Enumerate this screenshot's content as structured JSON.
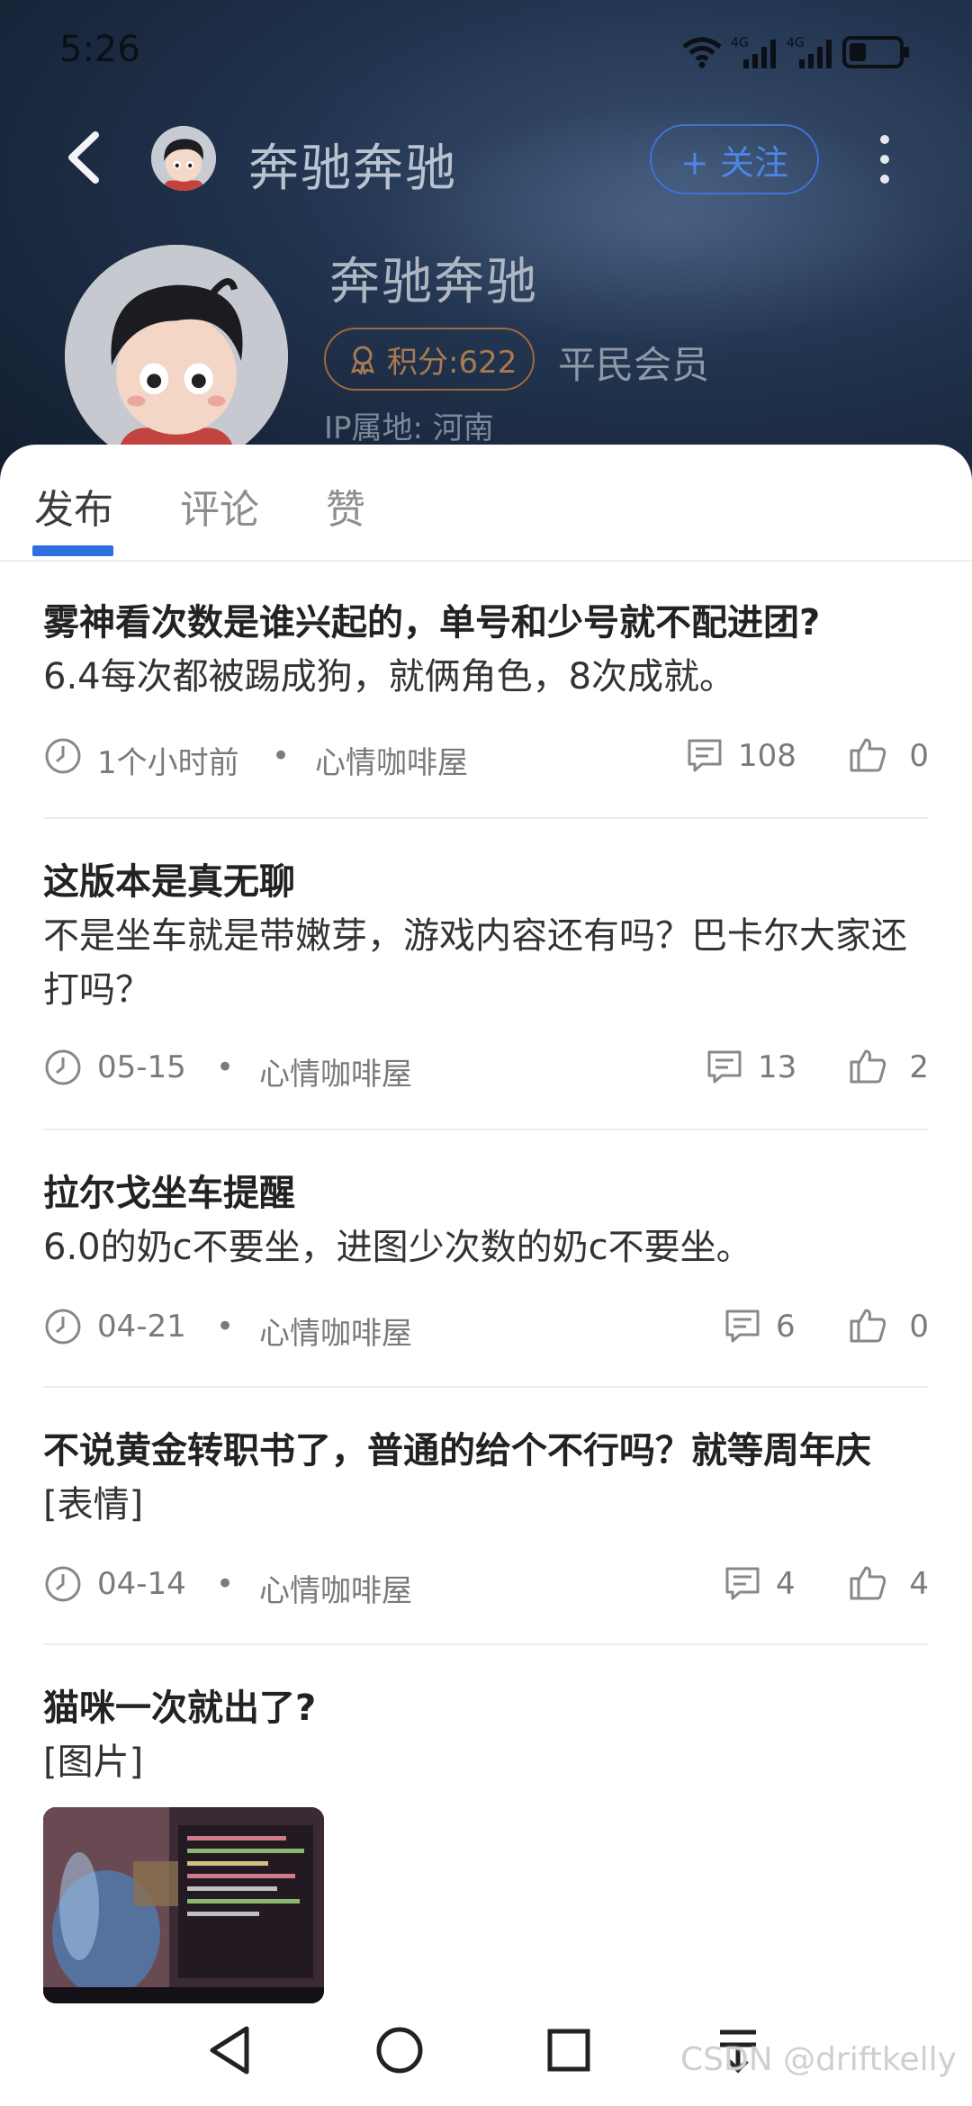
{
  "status_bar": {
    "time": "5:26",
    "network_1": "4G",
    "network_2": "4G"
  },
  "header": {
    "title": "奔驰奔驰",
    "follow_label": "+ 关注"
  },
  "profile": {
    "name": "奔驰奔驰",
    "points_label": "积分:622",
    "member_level": "平民会员",
    "ip_location": "IP属地: 河南"
  },
  "tabs": [
    {
      "label": "发布",
      "active": true
    },
    {
      "label": "评论",
      "active": false
    },
    {
      "label": "赞",
      "active": false
    }
  ],
  "posts": [
    {
      "title": "雾神看次数是谁兴起的，单号和少号就不配进团?",
      "body": "6.4每次都被踢成狗，就俩角色，8次成就。",
      "time": "1个小时前",
      "forum": "心情咖啡屋",
      "comments": "108",
      "likes": "0"
    },
    {
      "title": "这版本是真无聊",
      "body": "不是坐车就是带嫩芽，游戏内容还有吗？巴卡尔大家还打吗？",
      "time": "05-15",
      "forum": "心情咖啡屋",
      "comments": "13",
      "likes": "2"
    },
    {
      "title": "拉尔戈坐车提醒",
      "body": "6.0的奶c不要坐，进图少次数的奶c不要坐。",
      "time": "04-21",
      "forum": "心情咖啡屋",
      "comments": "6",
      "likes": "0"
    },
    {
      "title": "不说黄金转职书了，普通的给个不行吗？就等周年庆",
      "body": "[表情]",
      "time": "04-14",
      "forum": "心情咖啡屋",
      "comments": "4",
      "likes": "4"
    },
    {
      "title": "猫咪一次就出了?",
      "body": "[图片]"
    }
  ],
  "meta_separator": "•",
  "watermark": "CSDN @driftkelly",
  "colors": {
    "accent": "#2d6fe0",
    "header_bg": "#1c2b42",
    "points": "#a06a3a"
  }
}
